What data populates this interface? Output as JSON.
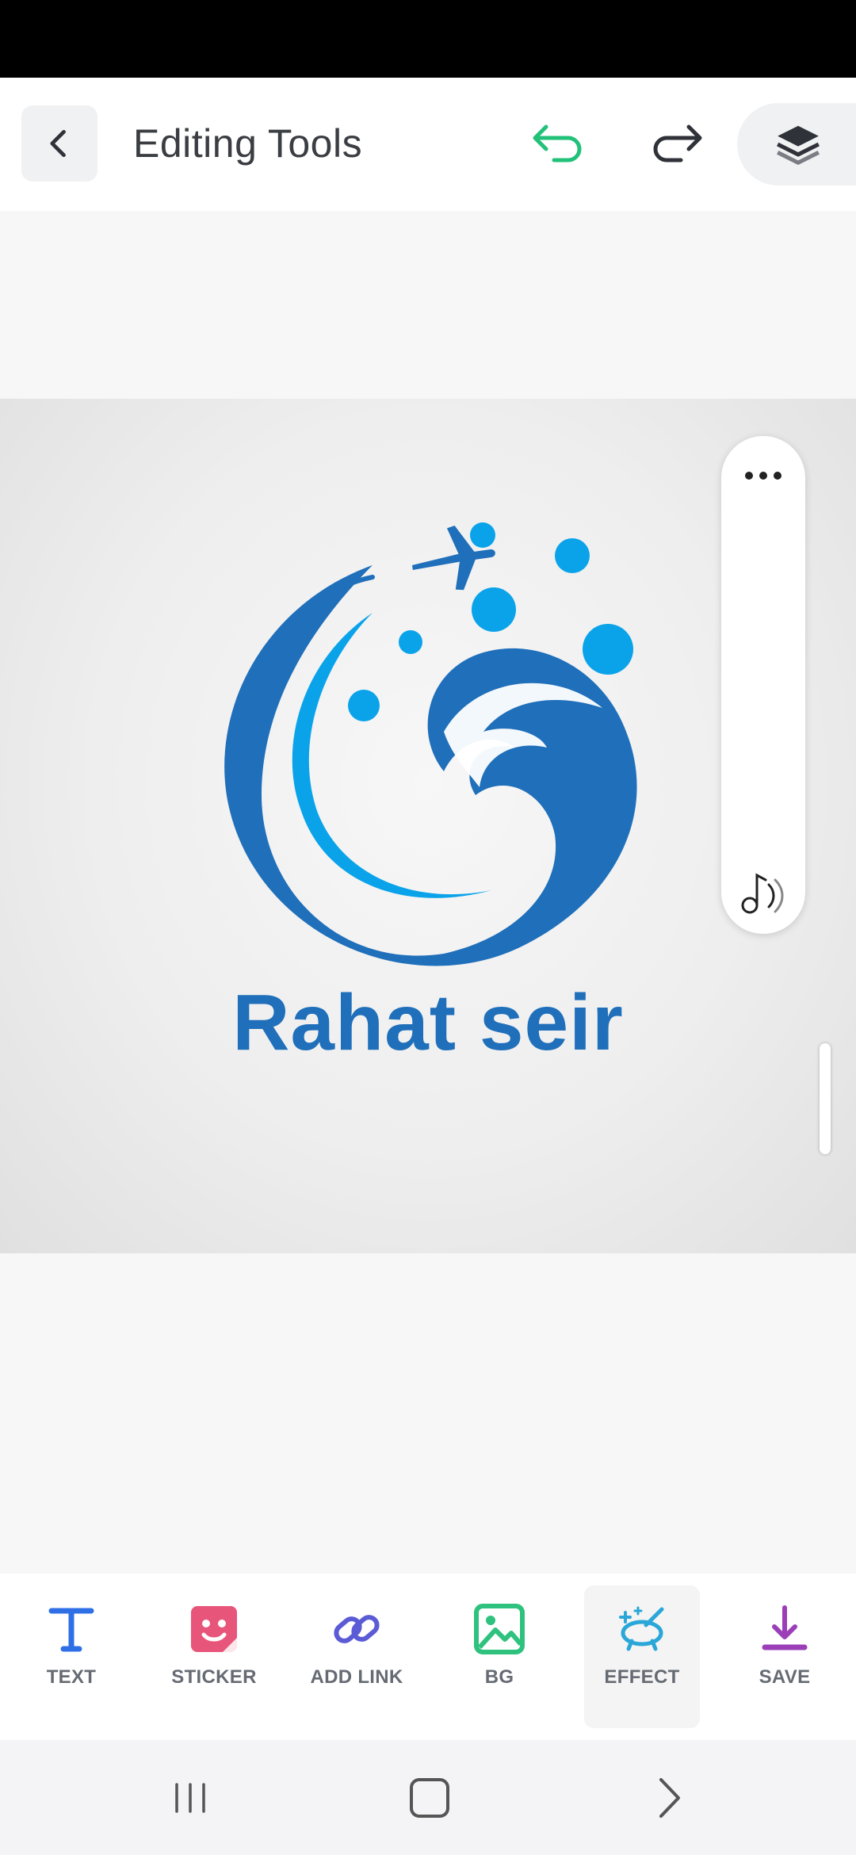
{
  "header": {
    "title": "Editing Tools"
  },
  "logo": {
    "brand_text": "Rahat seir",
    "colors": {
      "primary": "#1f6fba",
      "accent": "#0aa3ea"
    }
  },
  "toolbar": {
    "items": [
      {
        "label": "TEXT",
        "icon": "text-icon",
        "color": "#2f6fe6"
      },
      {
        "label": "STICKER",
        "icon": "sticker-icon",
        "color": "#e8557a"
      },
      {
        "label": "ADD LINK",
        "icon": "link-icon",
        "color": "#5b5bd6"
      },
      {
        "label": "BG",
        "icon": "image-icon",
        "color": "#2ec27e"
      },
      {
        "label": "EFFECT",
        "icon": "effect-icon",
        "color": "#2aa7d8"
      },
      {
        "label": "SAVE",
        "icon": "download-icon",
        "color": "#9b3fb8"
      }
    ],
    "active": "EFFECT"
  },
  "colors": {
    "undo": "#22c17a",
    "redo": "#2f3238"
  }
}
